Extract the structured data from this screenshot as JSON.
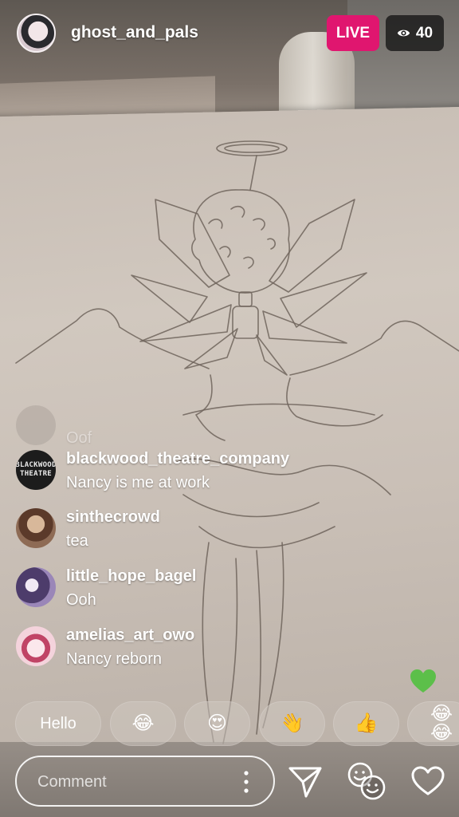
{
  "header": {
    "username": "ghost_and_pals",
    "live_label": "LIVE",
    "viewer_count": "40"
  },
  "comments": [
    {
      "username": "",
      "text": "Oof",
      "avatar": "faded-avatar"
    },
    {
      "username": "blackwood_theatre_company",
      "text": "Nancy is me at work",
      "avatar": "blackwood-avatar",
      "avatar_text": [
        "BLACKWOOD",
        "THEATRE"
      ]
    },
    {
      "username": "sinthecrowd",
      "text": "tea",
      "avatar": "sinthecrowd-avatar"
    },
    {
      "username": "little_hope_bagel",
      "text": "Ooh",
      "avatar": "little-hope-avatar"
    },
    {
      "username": "amelias_art_owo",
      "text": "Nancy reborn",
      "avatar": "amelias-avatar"
    }
  ],
  "quick_reactions": [
    {
      "label": "Hello"
    },
    {
      "label": "😂"
    },
    {
      "label": "😍"
    },
    {
      "label": "👋"
    },
    {
      "label": "👍"
    },
    {
      "label": "😂😂"
    }
  ],
  "comment_input": {
    "placeholder": "Comment"
  },
  "icons": {
    "viewer": "eye-icon",
    "more": "more-vertical-icon",
    "send": "send-icon",
    "faces": "faces-icon",
    "like": "heart-icon",
    "floating": "green-heart-icon"
  },
  "colors": {
    "live_badge": "#e0166f",
    "viewer_badge": "#141414",
    "floating_heart": "#5cbf4a"
  }
}
